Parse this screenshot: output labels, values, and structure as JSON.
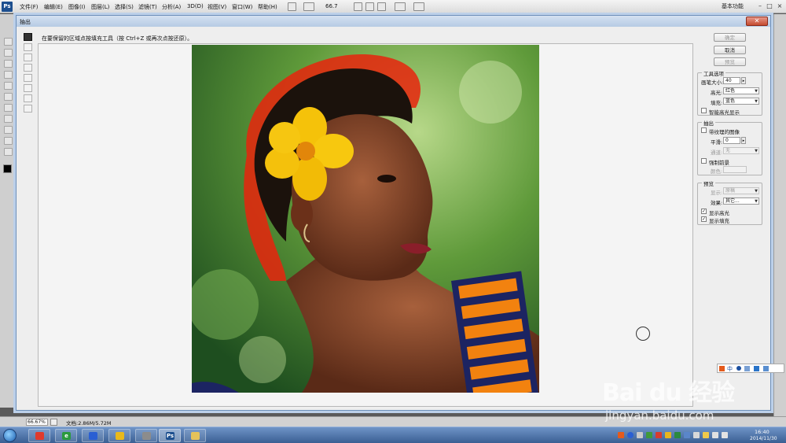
{
  "app": {
    "logo": "Ps"
  },
  "menu": {
    "items": [
      "文件(F)",
      "编辑(E)",
      "图像(I)",
      "图层(L)",
      "选择(S)",
      "滤镜(T)",
      "分析(A)",
      "3D(D)",
      "视图(V)",
      "窗口(W)",
      "帮助(H)"
    ],
    "zoom": "66.7",
    "workspace": "基本功能"
  },
  "dialog": {
    "title": "抽出",
    "hint": "在要保留的区域点按填充工具（按 Ctrl+Z 或再次点按还原）。",
    "buttons": {
      "ok": "确定",
      "cancel": "取消",
      "preview": "预览"
    },
    "tool_options": {
      "title": "工具选项",
      "brush_size_label": "画笔大小:",
      "brush_size_value": "40",
      "highlight_label": "高光:",
      "highlight_value": "红色",
      "fill_label": "填充:",
      "fill_value": "蓝色",
      "smart_highlight_label": "智能高光显示",
      "smart_highlight_checked": false
    },
    "extraction": {
      "title": "抽出",
      "textured_label": "带纹理的图像",
      "textured_checked": false,
      "smooth_label": "平滑:",
      "smooth_value": "0",
      "channel_label": "通道:",
      "channel_value": "无",
      "force_fg_label": "强制前景",
      "force_fg_checked": false,
      "color_label": "颜色:"
    },
    "preview_group": {
      "title": "预览",
      "show_label": "显示:",
      "show_value": "原稿",
      "effect_label": "效果:",
      "effect_value": "其它...",
      "show_highlight_label": "显示高光",
      "show_highlight_checked": true,
      "show_fill_label": "显示填充",
      "show_fill_checked": true
    }
  },
  "statusbar": {
    "zoom": "66.67%",
    "doc_info": "文档:2.86M/5.72M"
  },
  "taskbar": {
    "clock_time": "16:40",
    "clock_date": "2014/11/30"
  },
  "watermark": {
    "main": "Bai du 经验",
    "url": "jingyan.baidu.com"
  },
  "colors": {
    "highlight": "#e8250d",
    "accent": "#1d4f8f"
  }
}
